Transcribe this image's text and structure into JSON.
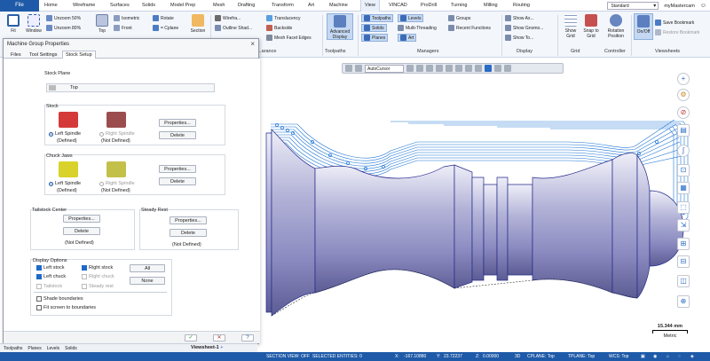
{
  "menubar": {
    "file": "File",
    "tabs": [
      "Home",
      "Wireframe",
      "Surfaces",
      "Solids",
      "Model Prep",
      "Mesh",
      "Drafting",
      "Transform",
      "Art",
      "Machine",
      "View",
      "VINCAD",
      "ProDrill",
      "Turning",
      "Milling",
      "Routing"
    ],
    "active_tab": "View",
    "config": "Standard",
    "account": "myMastercam"
  },
  "ribbon": {
    "fit": "Fit",
    "window": "Window",
    "unzoom_50": "Unzoom 50%",
    "unzoom_80": "Unzoom 80%",
    "top": "Top",
    "isometric": "Isometric",
    "front": "Front",
    "rotate": "Rotate",
    "cplane": "= Cplane",
    "section": "Section",
    "wireframe": "Wirefra...",
    "outline_shaded": "Outline Shad...",
    "translucency": "Translucency",
    "backside": "Backside",
    "mesh_facet_edges": "Mesh Facet Edges",
    "advanced_display": "Advanced Display",
    "toolpaths": "Toolpaths",
    "solids": "Solids",
    "planes": "Planes",
    "levels": "Levels",
    "multi_threading": "Multi-Threading",
    "art": "Art",
    "groups": "Groups",
    "recent_functions": "Recent Functions",
    "show_axes": "Show Ax...",
    "show_gnomons": "Show Gnomo...",
    "show_to": "Show To...",
    "show_grid": "Show Grid",
    "snap_to_grid": "Snap to Grid",
    "rotation_position": "Rotation Position",
    "on_off": "On/Off",
    "save_bookmark": "Save Bookmark",
    "restore_bookmark": "Restore Bookmark",
    "groups_labels": {
      "appearance": "...arance",
      "toolpaths": "Toolpaths",
      "managers": "Managers",
      "display": "Display",
      "grid": "Grid",
      "controller": "Controller",
      "viewsheets": "Viewsheets"
    }
  },
  "viewbar": {
    "autocursor": "AutoCursor"
  },
  "dialog": {
    "title": "Machine Group Properties",
    "close": "×",
    "tabs": [
      "Files",
      "Tool Settings",
      "Stock Setup"
    ],
    "active_tab": "Stock Setup",
    "stock_plane_label": "Stock Plane",
    "stock_plane_value": "Top",
    "stock_label": "Stock",
    "left_spindle": "Left Spindle",
    "right_spindle": "Right Spindle",
    "defined": "(Defined)",
    "not_defined": "(Not Defined)",
    "properties": "Properties...",
    "delete": "Delete",
    "chuck_jaws_label": "Chuck Jaws",
    "tailstock_label": "Tailstock Center",
    "steady_rest_label": "Steady Rest",
    "tailstock_properties": "Properties...",
    "tailstock_delete": "Delete",
    "steady_properties": "Properties...",
    "steady_delete": "Delete",
    "display_options_label": "Display Options",
    "left_stock": "Left stock",
    "right_stock": "Right stock",
    "left_chuck": "Left chuck",
    "right_chuck": "Right chuck",
    "tailstock": "Tailstock",
    "steady_rest": "Steady rest",
    "all": "All",
    "none": "None",
    "shade_boundaries": "Shade boundaries",
    "fit_screen": "Fit screen to boundaries",
    "ok": "✓",
    "cancel": "✕",
    "help": "?"
  },
  "scale": {
    "value": "15.344 mm",
    "units": "Metric"
  },
  "manager_tabs": [
    "Toolpaths",
    "Planes",
    "Levels",
    "Solids"
  ],
  "viewsheet": "Viewsheet-1",
  "status": {
    "section_view": "SECTION VIEW: OFF",
    "selected": "SELECTED ENTITIES: 0",
    "x_label": "X:",
    "x": "-167.10880",
    "y_label": "Y:",
    "y": "23.72237",
    "z_label": "Z:",
    "z": "0.00000",
    "mode": "3D",
    "cplane": "CPLANE: Top",
    "tplane": "TPLANE: Top",
    "wcs": "WCS: Top"
  },
  "colors": {
    "file_blue": "#1e5aa8",
    "toolpath_blue": "#1d74d6",
    "part_shade": "#9797c4"
  }
}
